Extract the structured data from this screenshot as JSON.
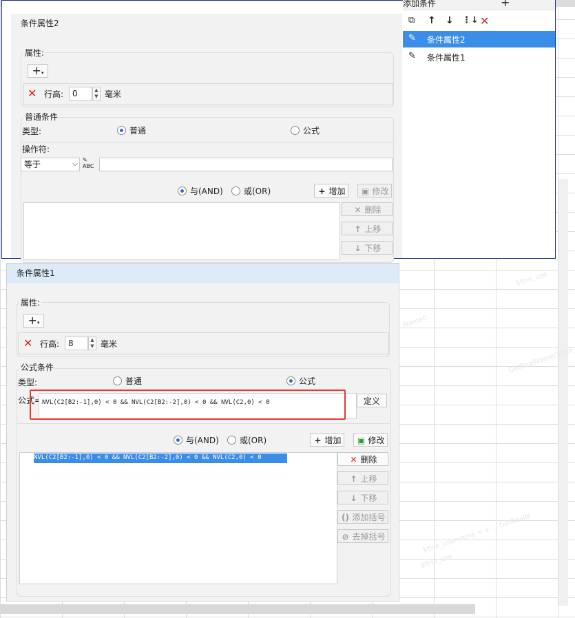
{
  "background": {
    "watermarks": [
      "$fine_use",
      "GetRealName($fine_username",
      "Name0",
      "$fine_username = e ... GetRealN",
      "$fine_use"
    ]
  },
  "right_panel": {
    "title": "添加条件",
    "add_symbol": "+",
    "toolbar_icons": [
      "copy-icon",
      "arrow-up-icon",
      "arrow-down-icon",
      "move-bottom-icon",
      "delete-icon"
    ],
    "items": [
      {
        "label": "条件属性2",
        "selected": true
      },
      {
        "label": "条件属性1",
        "selected": false
      }
    ]
  },
  "dialog2": {
    "title": "条件属性2",
    "attr_legend": "属性:",
    "add_symbol": "+",
    "row_height_label": "行高:",
    "row_height_value": "0",
    "unit": "毫米",
    "cond_legend": "普通条件",
    "type_label": "类型:",
    "radio_normal": "普通",
    "radio_formula": "公式",
    "selected_type": "normal",
    "operator_label": "操作符:",
    "operator_value": "等于",
    "and_label": "与(AND)",
    "or_label": "或(OR)",
    "add_btn": "增加",
    "modify_btn": "修改",
    "delete_btn": "删除",
    "up_btn": "上移",
    "down_btn": "下移"
  },
  "dialog1": {
    "title": "条件属性1",
    "attr_legend": "属性:",
    "add_symbol": "+",
    "row_height_label": "行高:",
    "row_height_value": "8",
    "unit": "毫米",
    "cond_legend": "公式条件",
    "type_label": "类型:",
    "radio_normal": "普通",
    "radio_formula": "公式",
    "selected_type": "formula",
    "formula_label": "公式=",
    "formula_value": "NVL(C2[B2:-1],0) < 0 && NVL(C2[B2:-2],0) < 0 && NVL(C2,0) < 0",
    "define_btn": "定义",
    "and_label": "与(AND)",
    "or_label": "或(OR)",
    "add_btn": "增加",
    "modify_btn": "修改",
    "delete_btn": "删除",
    "up_btn": "上移",
    "down_btn": "下移",
    "add_bracket_btn": "添加括号",
    "remove_bracket_btn": "去掉括号",
    "conditions": [
      "NVL(C2[B2:-1],0) < 0 && NVL(C2[B2:-2],0) < 0 && NVL(C2,0) < 0"
    ],
    "highlight_color": "#e53935",
    "selection_color": "#3b8ee8"
  }
}
